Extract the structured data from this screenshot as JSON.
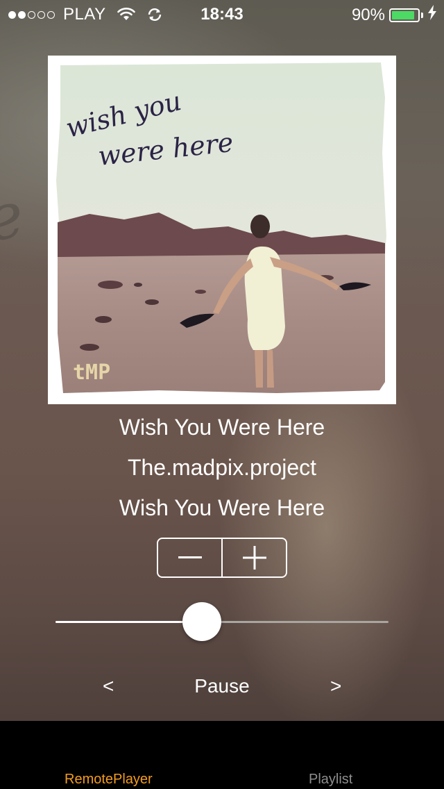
{
  "status_bar": {
    "carrier": "PLAY",
    "time": "18:43",
    "battery_percent_label": "90%",
    "battery_level": 0.9,
    "signal_bars_filled": 2,
    "signal_bars_total": 5
  },
  "album": {
    "cover_script_line1": "wish you",
    "cover_script_line2": "were here",
    "cover_logo": "tMP"
  },
  "track": {
    "title": "Wish You Were Here",
    "artist": "The.madpix.project",
    "album": "Wish You Were Here"
  },
  "volume": {
    "decrease_icon": "minus-icon",
    "increase_icon": "plus-icon"
  },
  "seek": {
    "progress_fraction": 0.44
  },
  "controls": {
    "prev_label": "<",
    "play_pause_label": "Pause",
    "next_label": ">"
  },
  "tabs": [
    {
      "label": "RemotePlayer",
      "selected": true
    },
    {
      "label": "Playlist",
      "selected": false
    }
  ],
  "colors": {
    "accent": "#f39c1f",
    "battery_fill": "#4cd964",
    "tab_inactive": "#8e8e8e"
  }
}
